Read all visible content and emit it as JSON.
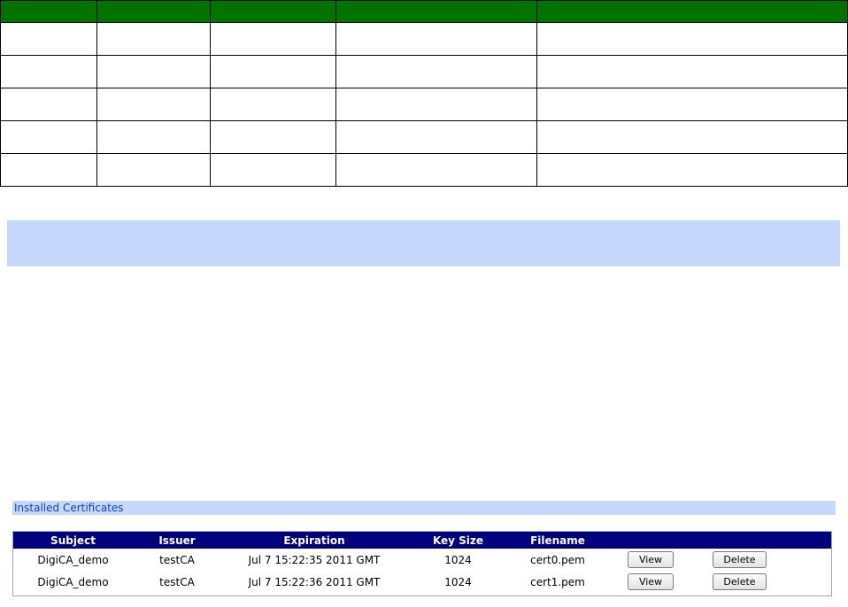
{
  "top_grid": {
    "columns": 5,
    "rows": 5
  },
  "installed_certificates": {
    "title": "Installed Certificates",
    "columns": [
      "Subject",
      "Issuer",
      "Expiration",
      "Key Size",
      "Filename",
      "",
      ""
    ],
    "rows": [
      {
        "subject": "DigiCA_demo",
        "issuer": "testCA",
        "expiration": "Jul 7 15:22:35 2011 GMT",
        "key_size": "1024",
        "filename": "cert0.pem",
        "view_label": "View",
        "delete_label": "Delete"
      },
      {
        "subject": "DigiCA_demo",
        "issuer": "testCA",
        "expiration": "Jul 7 15:22:36 2011 GMT",
        "key_size": "1024",
        "filename": "cert1.pem",
        "view_label": "View",
        "delete_label": "Delete"
      }
    ]
  },
  "colors": {
    "green_header": "#007400",
    "light_blue": "#c6d8fb",
    "navy_header": "#00007f",
    "link_blue": "#0f3dd6"
  }
}
